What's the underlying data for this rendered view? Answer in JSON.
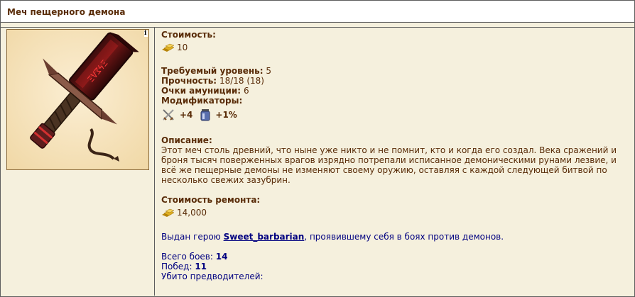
{
  "window": {
    "title": "Меч пещерного демона"
  },
  "item": {
    "info_icon_label": "i",
    "cost_label": "Стоимость:",
    "cost_value": "10",
    "level_label": "Требуемый уровень:",
    "level_value": "5",
    "durability_label": "Прочность:",
    "durability_value": "18/18",
    "durability_max": "(18)",
    "ammo_label": "Очки амуниции:",
    "ammo_value": "6",
    "modifiers_label": "Модификаторы:",
    "modifiers": [
      {
        "icon": "crossed-swords-icon",
        "value": "+4"
      },
      {
        "icon": "potion-jar-icon",
        "value": "+1%"
      }
    ],
    "description_label": "Описание:",
    "description": "Этот меч столь древний, что ныне уже никто и не помнит, кто и когда его создал. Века сражений и броня тысяч поверженных врагов изрядно потрепали исписанное демоническими рунами лезвие, и всё же пещерные демоны не изменяют своему оружию, оставляя с каждой следующей битвой по несколько свежих зазубрин.",
    "repair_label": "Стоимость ремонта:",
    "repair_value": "14,000",
    "given_prefix": "Выдан герою",
    "hero_name": "Sweet_barbarian",
    "given_suffix": ", проявившему себя в боях против демонов.",
    "battles_label": "Всего боев:",
    "battles_value": "14",
    "wins_label": "Побед:",
    "wins_value": "11",
    "predecessors_label": "Убито предводителей:"
  },
  "colors": {
    "background": "#f5f0dd",
    "text": "#592c08",
    "link": "#000080",
    "border": "#5d5d5d"
  }
}
